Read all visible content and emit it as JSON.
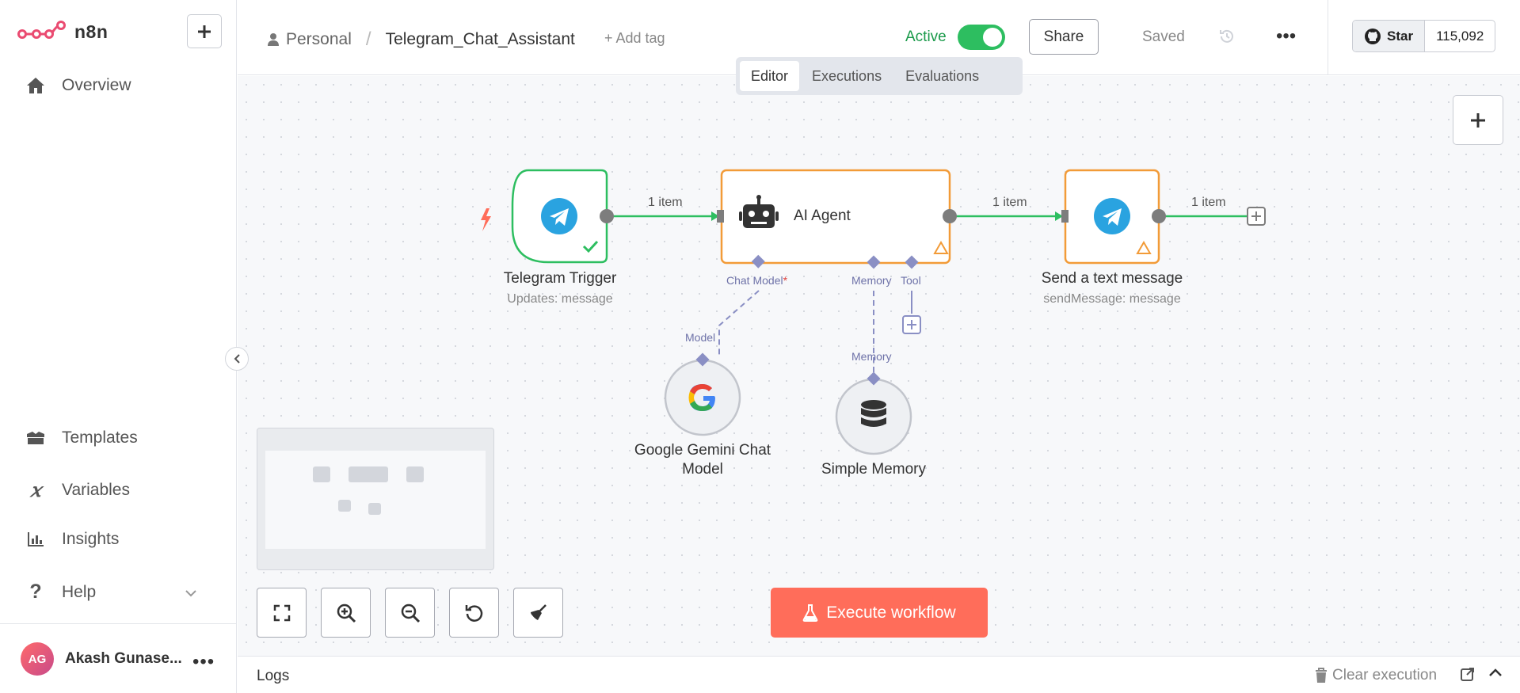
{
  "app": {
    "logo_text": "n8n"
  },
  "sidebar": {
    "items": [
      {
        "label": "Overview",
        "icon": "home-icon"
      },
      {
        "label": "Templates",
        "icon": "templates-icon"
      },
      {
        "label": "Variables",
        "icon": "variables-icon"
      },
      {
        "label": "Insights",
        "icon": "insights-icon"
      },
      {
        "label": "Help",
        "icon": "help-icon"
      }
    ],
    "user": {
      "initials": "AG",
      "name": "Akash Gunase..."
    }
  },
  "header": {
    "breadcrumb": {
      "scope": "Personal",
      "workflow_name": "Telegram_Chat_Assistant"
    },
    "add_tag": "+ Add tag",
    "active_label": "Active",
    "active": true,
    "share_label": "Share",
    "saved_label": "Saved",
    "github": {
      "star_label": "Star",
      "count": "115,092"
    }
  },
  "tabs": [
    {
      "label": "Editor",
      "active": true
    },
    {
      "label": "Executions",
      "active": false
    },
    {
      "label": "Evaluations",
      "active": false
    }
  ],
  "canvas": {
    "nodes": {
      "telegram_trigger": {
        "title": "Telegram Trigger",
        "subtitle": "Updates: message"
      },
      "ai_agent": {
        "title": "AI Agent"
      },
      "send_message": {
        "title": "Send a text message",
        "subtitle": "sendMessage: message"
      },
      "gemini": {
        "title_line1": "Google Gemini Chat",
        "title_line2": "Model"
      },
      "memory": {
        "title": "Simple Memory"
      }
    },
    "connection_labels": {
      "c1": "1 item",
      "c2": "1 item",
      "c3": "1 item"
    },
    "ports": {
      "chat_model": "Chat Model",
      "chat_model_required": "*",
      "memory": "Memory",
      "tool": "Tool",
      "model_input": "Model",
      "memory_input": "Memory"
    },
    "execute_label": "Execute workflow"
  },
  "logs": {
    "label": "Logs",
    "clear_label": "Clear execution"
  },
  "colors": {
    "accent": "#ff6d5a",
    "success": "#2dbe60",
    "warning": "#f59e0b",
    "telegram": "#2aa3e0",
    "subnode_port": "#8a8fc4"
  }
}
